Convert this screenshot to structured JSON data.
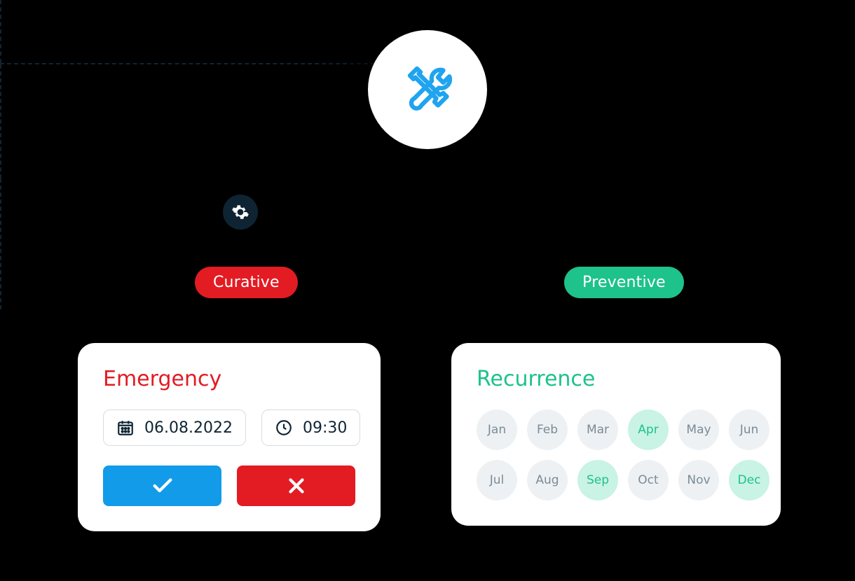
{
  "root": {
    "icon": "tools-icon"
  },
  "gear": {
    "icon": "gear-icon"
  },
  "pills": {
    "curative": "Curative",
    "preventive": "Preventive"
  },
  "emergency": {
    "title": "Emergency",
    "date": "06.08.2022",
    "time": "09:30"
  },
  "recurrence": {
    "title": "Recurrence",
    "months": [
      {
        "label": "Jan",
        "active": false
      },
      {
        "label": "Feb",
        "active": false
      },
      {
        "label": "Mar",
        "active": false
      },
      {
        "label": "Apr",
        "active": true
      },
      {
        "label": "May",
        "active": false
      },
      {
        "label": "Jun",
        "active": false
      },
      {
        "label": "Jul",
        "active": false
      },
      {
        "label": "Aug",
        "active": false
      },
      {
        "label": "Sep",
        "active": true
      },
      {
        "label": "Oct",
        "active": false
      },
      {
        "label": "Nov",
        "active": false
      },
      {
        "label": "Dec",
        "active": true
      }
    ]
  },
  "colors": {
    "red": "#e31b23",
    "green": "#1ec28b",
    "blue": "#119be9",
    "ink": "#0f2433"
  }
}
